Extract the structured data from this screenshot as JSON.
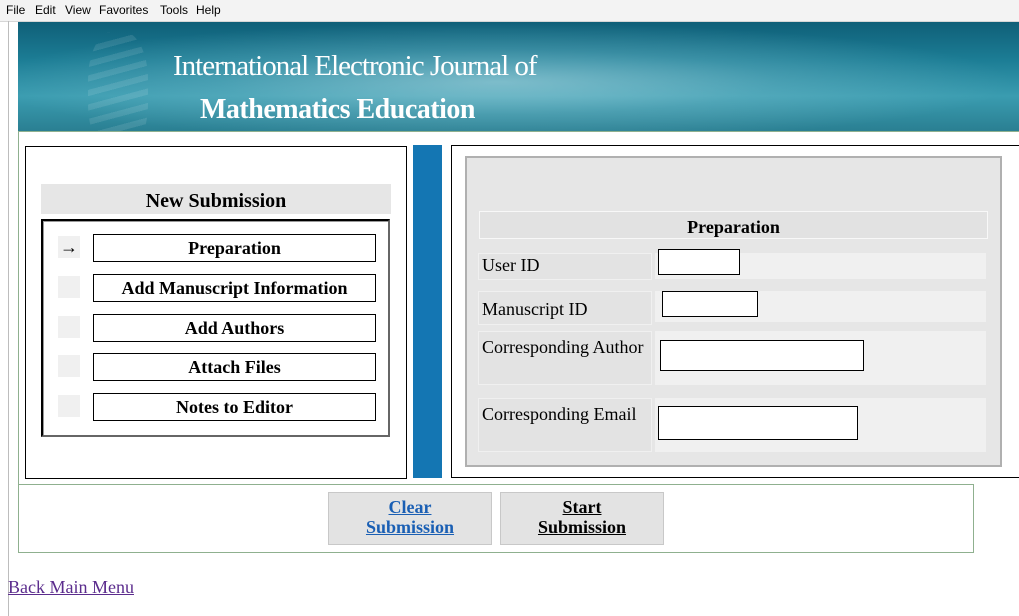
{
  "menu": [
    "File",
    "Edit",
    "View",
    "Favorites",
    "Tools",
    "Help"
  ],
  "banner": {
    "line1": "International Electronic Journal of",
    "line2": "Mathematics Education"
  },
  "left_panel": {
    "header": "New Submission",
    "current_marker": "→",
    "steps": [
      {
        "label": "Preparation",
        "current": true
      },
      {
        "label": "Add Manuscript Information",
        "current": false
      },
      {
        "label": "Add Authors",
        "current": false
      },
      {
        "label": "Attach Files",
        "current": false
      },
      {
        "label": "Notes to Editor",
        "current": false
      }
    ]
  },
  "form": {
    "title": "Preparation",
    "fields": [
      {
        "label": "User ID",
        "value": ""
      },
      {
        "label": "Manuscript ID",
        "value": ""
      },
      {
        "label": "Corresponding Author",
        "value": ""
      },
      {
        "label": "Corresponding Email",
        "value": ""
      }
    ]
  },
  "actions": {
    "clear": {
      "line1": "Clear",
      "line2": "Submission"
    },
    "start": {
      "line1": "Start",
      "line2": "Submission"
    }
  },
  "back_link": "Back Main Menu",
  "colors": {
    "side_bar": "#1476b3",
    "banner_base": "#1c7d95",
    "link_clear": "#1a5fb4",
    "link_visited": "#5b2c8d"
  }
}
